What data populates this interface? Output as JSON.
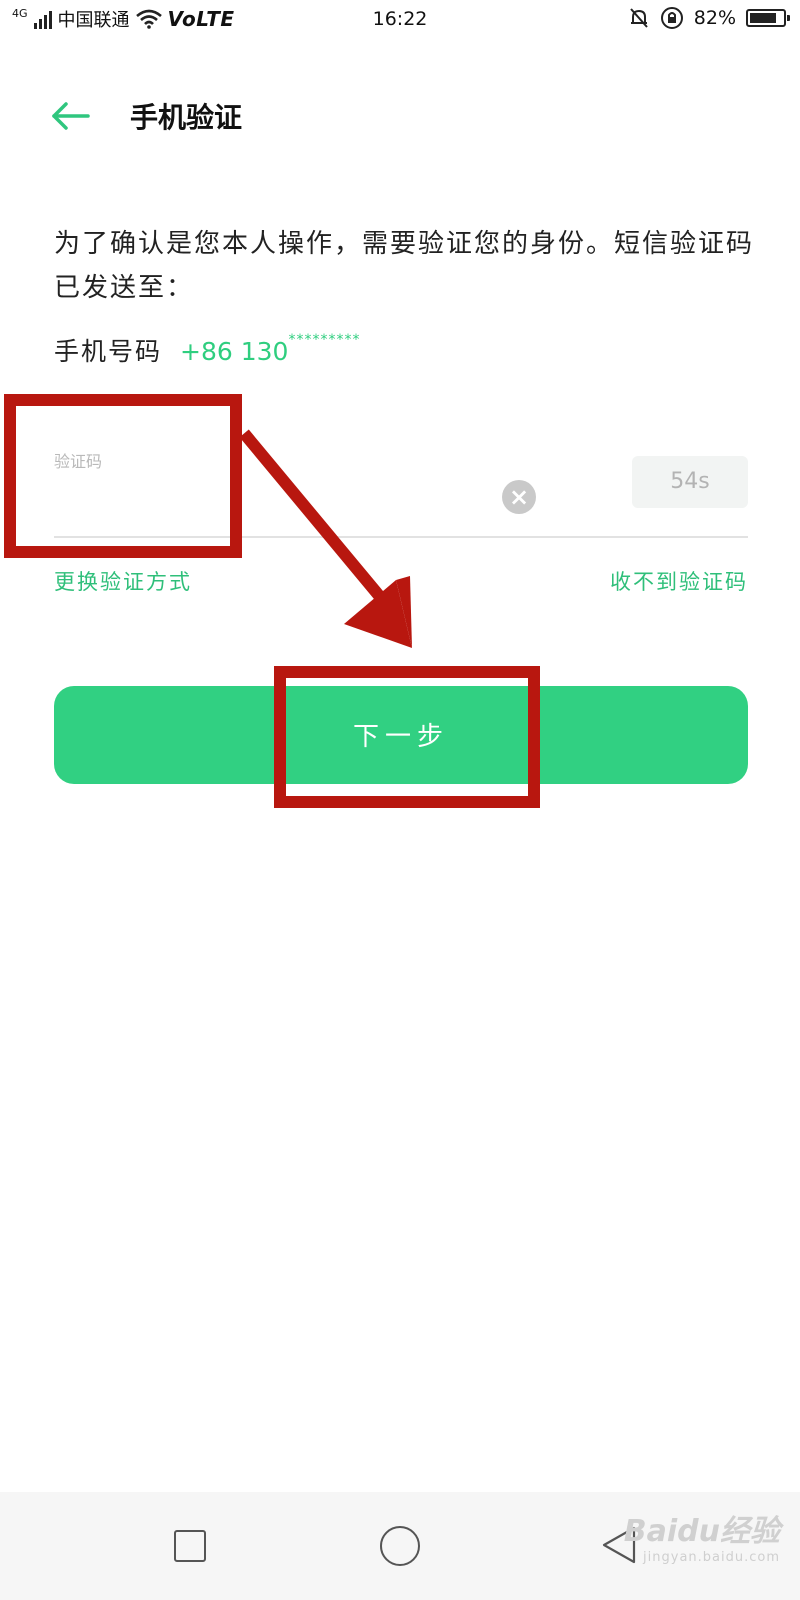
{
  "status_bar": {
    "network_type": "4G",
    "carrier": "中国联通",
    "volte": "VoLTE",
    "time": "16:22",
    "battery_percent": "82%",
    "battery_level": 0.82
  },
  "header": {
    "title": "手机验证"
  },
  "content": {
    "description": "为了确认是您本人操作，需要验证您的身份。短信验证码已发送至：",
    "phone_label": "手机号码",
    "phone_number": "+86 130",
    "phone_mask": "*********"
  },
  "code_input": {
    "placeholder": "验证码",
    "value": "",
    "countdown": "54s",
    "clear_symbol": "×"
  },
  "links": {
    "switch_method": "更换验证方式",
    "no_code": "收不到验证码"
  },
  "next_button": {
    "label": "下一步"
  },
  "watermark": {
    "main": "Baidu经验",
    "sub": "jingyan.baidu.com"
  },
  "colors": {
    "accent": "#31d082",
    "annotation": "#b8170f"
  }
}
